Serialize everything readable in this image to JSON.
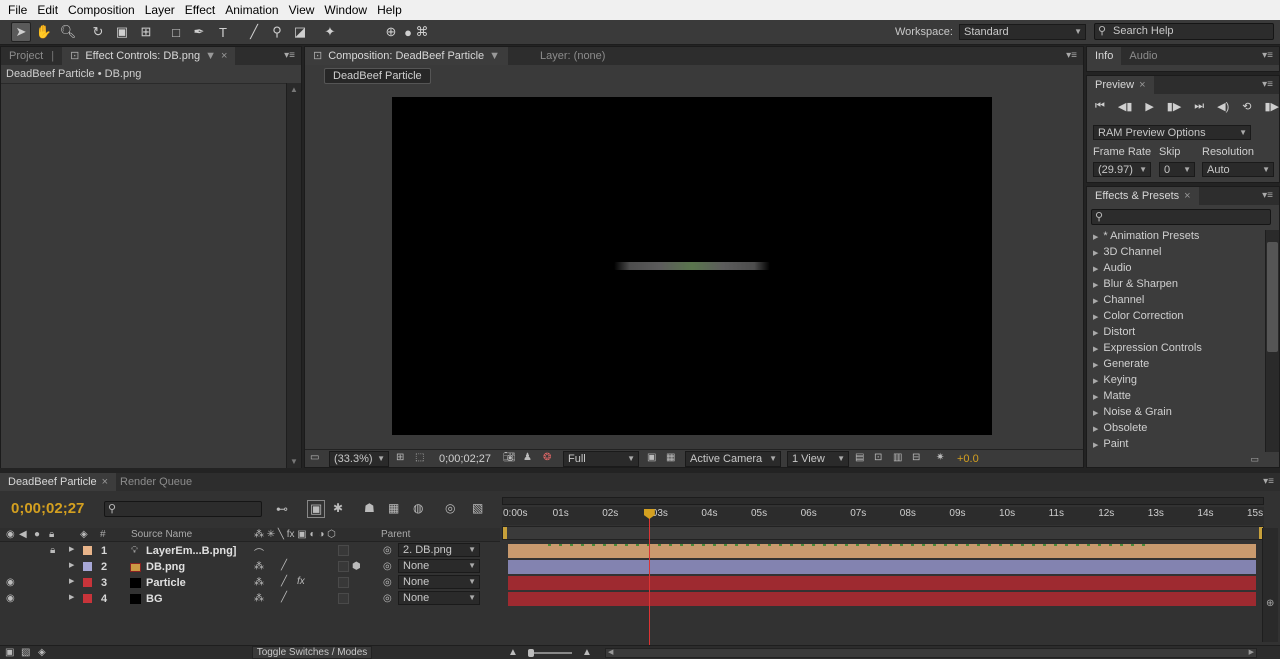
{
  "menu": [
    "File",
    "Edit",
    "Composition",
    "Layer",
    "Effect",
    "Animation",
    "View",
    "Window",
    "Help"
  ],
  "workspace": {
    "label": "Workspace:",
    "value": "Standard"
  },
  "search_help": {
    "placeholder": "Search Help"
  },
  "left_panel": {
    "tabs": [
      {
        "label": "Project"
      },
      {
        "label": "Effect Controls: DB.png"
      }
    ],
    "breadcrumb": "DeadBeef Particle • DB.png"
  },
  "comp_panel": {
    "tabs": [
      {
        "label": "Composition: DeadBeef Particle"
      },
      {
        "label": "Layer: (none)"
      }
    ],
    "subtab": "DeadBeef Particle",
    "bottom": {
      "zoom": "(33.3%)",
      "timecode": "0;00;02;27",
      "resolution": "Full",
      "camera": "Active Camera",
      "views": "1 View",
      "exposure": "+0.0"
    }
  },
  "info_panel": {
    "tabs": [
      {
        "label": "Info"
      },
      {
        "label": "Audio"
      }
    ]
  },
  "preview_panel": {
    "tab": "Preview",
    "ram_options": "RAM Preview Options",
    "frame_rate_label": "Frame Rate",
    "skip_label": "Skip",
    "resolution_label": "Resolution",
    "frame_rate_value": "(29.97)",
    "skip_value": "0",
    "resolution_value": "Auto"
  },
  "effects_panel": {
    "tab": "Effects & Presets",
    "items": [
      "* Animation Presets",
      "3D Channel",
      "Audio",
      "Blur & Sharpen",
      "Channel",
      "Color Correction",
      "Distort",
      "Expression Controls",
      "Generate",
      "Keying",
      "Matte",
      "Noise & Grain",
      "Obsolete",
      "Paint"
    ]
  },
  "timeline": {
    "tabs": [
      {
        "label": "DeadBeef Particle"
      },
      {
        "label": "Render Queue"
      }
    ],
    "timecode": "0;00;02;27",
    "col_num": "#",
    "col_source": "Source Name",
    "col_parent": "Parent",
    "layers": [
      {
        "num": "1",
        "name": "LayerEm...B.png]",
        "parent": "2. DB.png",
        "color": "#e8b48a",
        "track": "#c99a6e",
        "eye": false
      },
      {
        "num": "2",
        "name": "DB.png",
        "parent": "None",
        "color": "#a7a7d6",
        "track": "#8383b0",
        "eye": false
      },
      {
        "num": "3",
        "name": "Particle",
        "parent": "None",
        "color": "#c8343a",
        "track": "#9e2a30",
        "eye": true
      },
      {
        "num": "4",
        "name": "BG",
        "parent": "None",
        "color": "#c8343a",
        "track": "#9e2a30",
        "eye": true
      }
    ],
    "ruler": [
      "0:00s",
      "01s",
      "02s",
      "03s",
      "04s",
      "05s",
      "06s",
      "07s",
      "08s",
      "09s",
      "10s",
      "11s",
      "12s",
      "13s",
      "14s",
      "15s"
    ],
    "playhead_seconds": 2.9,
    "duration_seconds": 15,
    "toggle_label": "Toggle Switches / Modes",
    "fx_label": "fx"
  }
}
